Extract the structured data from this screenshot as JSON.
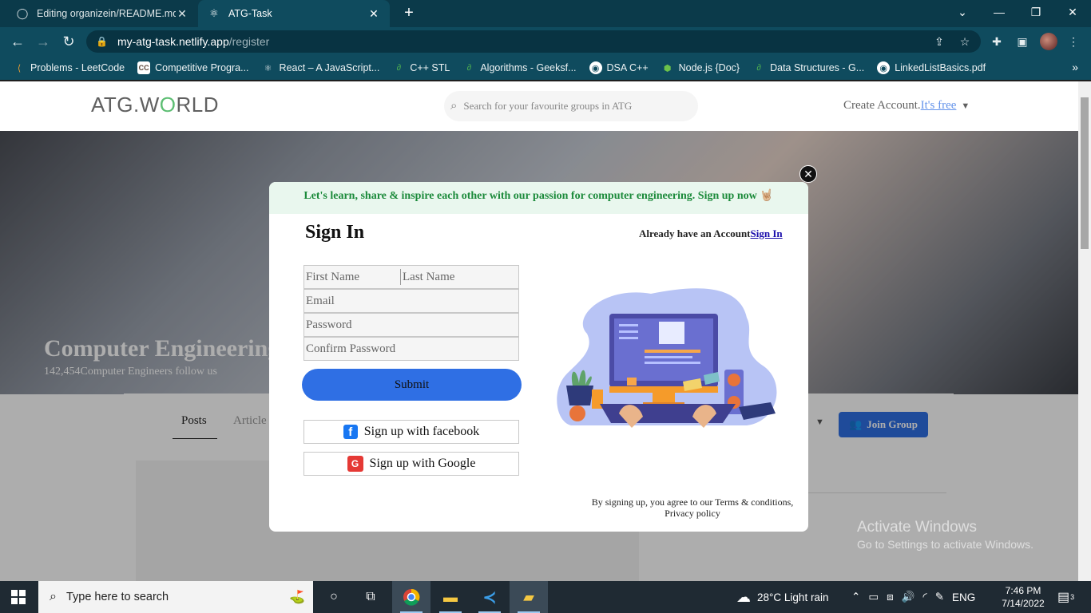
{
  "browser": {
    "tabs": [
      {
        "title": "Editing organizein/README.md a",
        "favicon": "github-icon",
        "active": false
      },
      {
        "title": "ATG-Task",
        "favicon": "react-icon",
        "active": true
      }
    ],
    "url_host": "my-atg-task.netlify.app",
    "url_path": "/register",
    "bookmarks": [
      {
        "label": "Problems - LeetCode",
        "icon": "leetcode-icon"
      },
      {
        "label": "Competitive Progra...",
        "icon": "codechef-icon"
      },
      {
        "label": "React – A JavaScript...",
        "icon": "react-icon"
      },
      {
        "label": "C++ STL",
        "icon": "gfg-icon"
      },
      {
        "label": "Algorithms - Geeksf...",
        "icon": "gfg-icon"
      },
      {
        "label": "DSA C++",
        "icon": "globe-icon"
      },
      {
        "label": "Node.js {Doc}",
        "icon": "nodejs-icon"
      },
      {
        "label": "Data Structures - G...",
        "icon": "gfg-icon"
      },
      {
        "label": "LinkedListBasics.pdf",
        "icon": "globe-icon"
      }
    ]
  },
  "site": {
    "logo_prefix": "ATG.W",
    "logo_o": "O",
    "logo_suffix": "RLD",
    "search_placeholder": "Search for your favourite groups in ATG",
    "create_account": "Create Account.",
    "its_free": "It's free",
    "hero_title": "Computer Engineering",
    "hero_sub": "142,454Computer Engineers follow us",
    "tab_posts": "Posts",
    "tab_articles": "Article",
    "join_group": "Join Group"
  },
  "modal": {
    "banner": "Let's learn, share & inspire each other with our passion for computer engineering. Sign up now 🤘🏼",
    "title": "Sign In",
    "have_account": "Already have an Account",
    "sign_in_link": "Sign In",
    "first_name_placeholder": "First Name",
    "last_name_placeholder": "Last Name",
    "email_placeholder": "Email",
    "password_placeholder": "Password",
    "confirm_password_placeholder": "Confirm Password",
    "submit": "Submit",
    "facebook": "Sign up with facebook",
    "google": "Sign up with Google",
    "terms_line1": "By signing up, you agree to our Terms & conditions,",
    "terms_line2": "Privacy policy"
  },
  "watermark": {
    "line1": "Activate Windows",
    "line2": "Go to Settings to activate Windows."
  },
  "taskbar": {
    "search_placeholder": "Type here to search",
    "weather": "28°C  Light rain",
    "language": "ENG",
    "time": "7:46 PM",
    "date": "7/14/2022",
    "notification_count": "3"
  }
}
